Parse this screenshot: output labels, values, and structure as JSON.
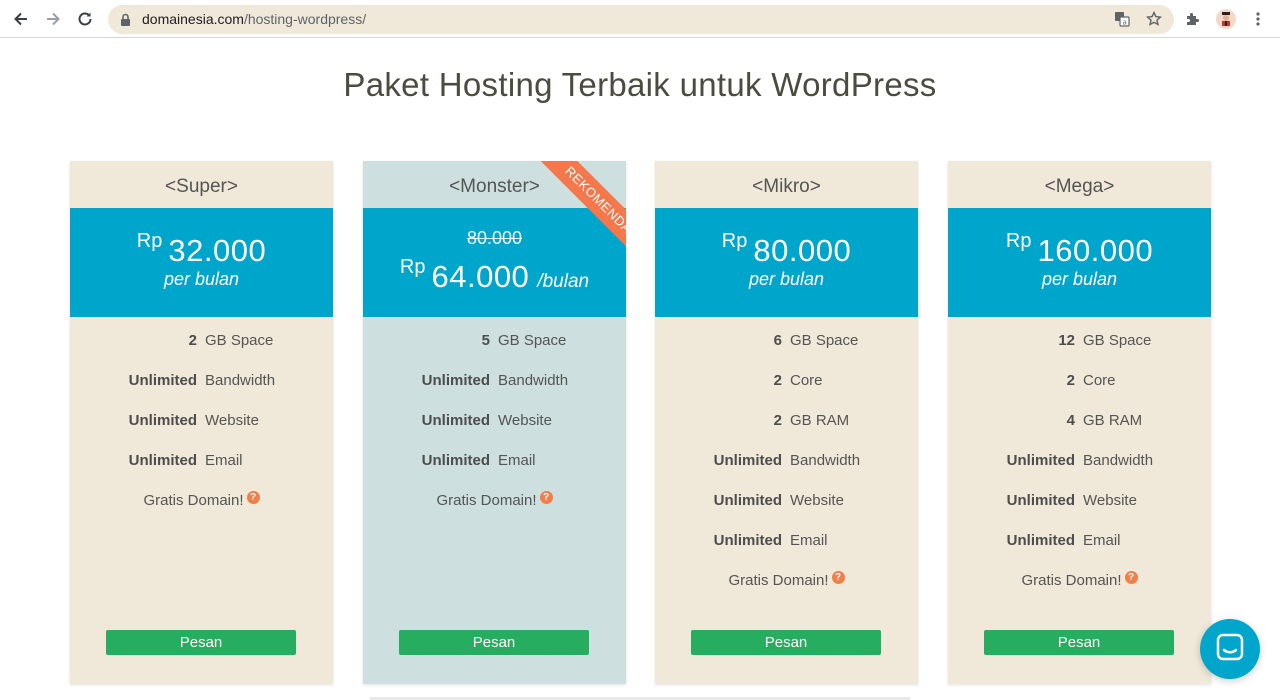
{
  "browser": {
    "url_host": "domainesia.com",
    "url_path": "/hosting-wordpress/"
  },
  "page": {
    "title": "Paket Hosting Terbaik untuk WordPress",
    "help_glyph": "?",
    "order_label": "Pesan"
  },
  "plans": [
    {
      "name": "<Super>",
      "currency": "Rp",
      "price": "32.000",
      "period": "per bulan",
      "features": [
        {
          "qty": "2",
          "label": "GB Space"
        },
        {
          "qty": "Unlimited",
          "label": "Bandwidth"
        },
        {
          "qty": "Unlimited",
          "label": "Website"
        },
        {
          "qty": "Unlimited",
          "label": "Email"
        }
      ],
      "domain": "Gratis Domain!"
    },
    {
      "name": "<Monster>",
      "ribbon": "REKOMENDASI",
      "old_price": "80.000",
      "currency": "Rp",
      "price": "64.000",
      "period": "/bulan",
      "features": [
        {
          "qty": "5",
          "label": "GB Space"
        },
        {
          "qty": "Unlimited",
          "label": "Bandwidth"
        },
        {
          "qty": "Unlimited",
          "label": "Website"
        },
        {
          "qty": "Unlimited",
          "label": "Email"
        }
      ],
      "domain": "Gratis Domain!"
    },
    {
      "name": "<Mikro>",
      "currency": "Rp",
      "price": "80.000",
      "period": "per bulan",
      "features": [
        {
          "qty": "6",
          "label": "GB Space"
        },
        {
          "qty": "2",
          "label": "Core"
        },
        {
          "qty": "2",
          "label": "GB RAM"
        },
        {
          "qty": "Unlimited",
          "label": "Bandwidth"
        },
        {
          "qty": "Unlimited",
          "label": "Website"
        },
        {
          "qty": "Unlimited",
          "label": "Email"
        }
      ],
      "domain": "Gratis Domain!"
    },
    {
      "name": "<Mega>",
      "currency": "Rp",
      "price": "160.000",
      "period": "per bulan",
      "features": [
        {
          "qty": "12",
          "label": "GB Space"
        },
        {
          "qty": "2",
          "label": "Core"
        },
        {
          "qty": "4",
          "label": "GB RAM"
        },
        {
          "qty": "Unlimited",
          "label": "Bandwidth"
        },
        {
          "qty": "Unlimited",
          "label": "Website"
        },
        {
          "qty": "Unlimited",
          "label": "Email"
        }
      ],
      "domain": "Gratis Domain!"
    }
  ],
  "icons": [
    "back-icon",
    "forward-icon",
    "reload-icon",
    "lock-icon",
    "translate-icon",
    "star-icon",
    "extensions-icon",
    "profile-icon",
    "menu-icon",
    "help-icon",
    "chat-icon"
  ],
  "colors": {
    "price_band": "#00a5cc",
    "card_bg": "#f0e8d8",
    "featured_bg": "#cddfdf",
    "ribbon": "#f4784b",
    "order_button": "#27ad5f",
    "help_icon": "#f07f4a"
  }
}
